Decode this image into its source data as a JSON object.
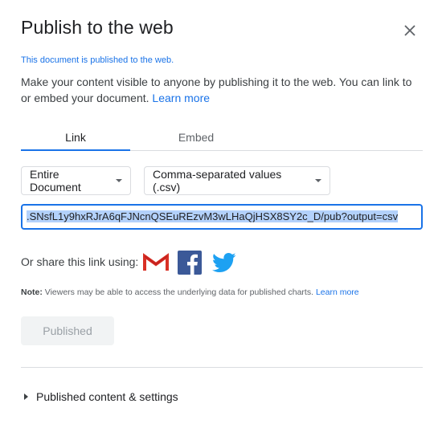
{
  "dialog": {
    "title": "Publish to the web",
    "status": "This document is published to the web.",
    "description": "Make your content visible to anyone by publishing it to the web. You can link to or embed your document.",
    "learn_more": "Learn more"
  },
  "tabs": {
    "link": "Link",
    "embed": "Embed",
    "active": "Link"
  },
  "options": {
    "scope": "Entire Document",
    "format": "Comma-separated values (.csv)"
  },
  "url": ".SNsfL1y9hxRJrA6qFJNcnQSEuREzvM3wLHaQjHSX8SY2c_D/pub?output=csv",
  "share": {
    "label": "Or share this link using:",
    "services": [
      "gmail-icon",
      "facebook-icon",
      "twitter-icon"
    ]
  },
  "note": {
    "prefix": "Note:",
    "text": " Viewers may be able to access the underlying data for published charts.",
    "learn_more": "Learn more"
  },
  "actions": {
    "published": "Published"
  },
  "advanced": {
    "label": "Published content & settings"
  },
  "colors": {
    "accent": "#1a73e8",
    "gmail_red": "#d93025",
    "facebook_blue": "#3b5998",
    "twitter_blue": "#1da1f2"
  }
}
